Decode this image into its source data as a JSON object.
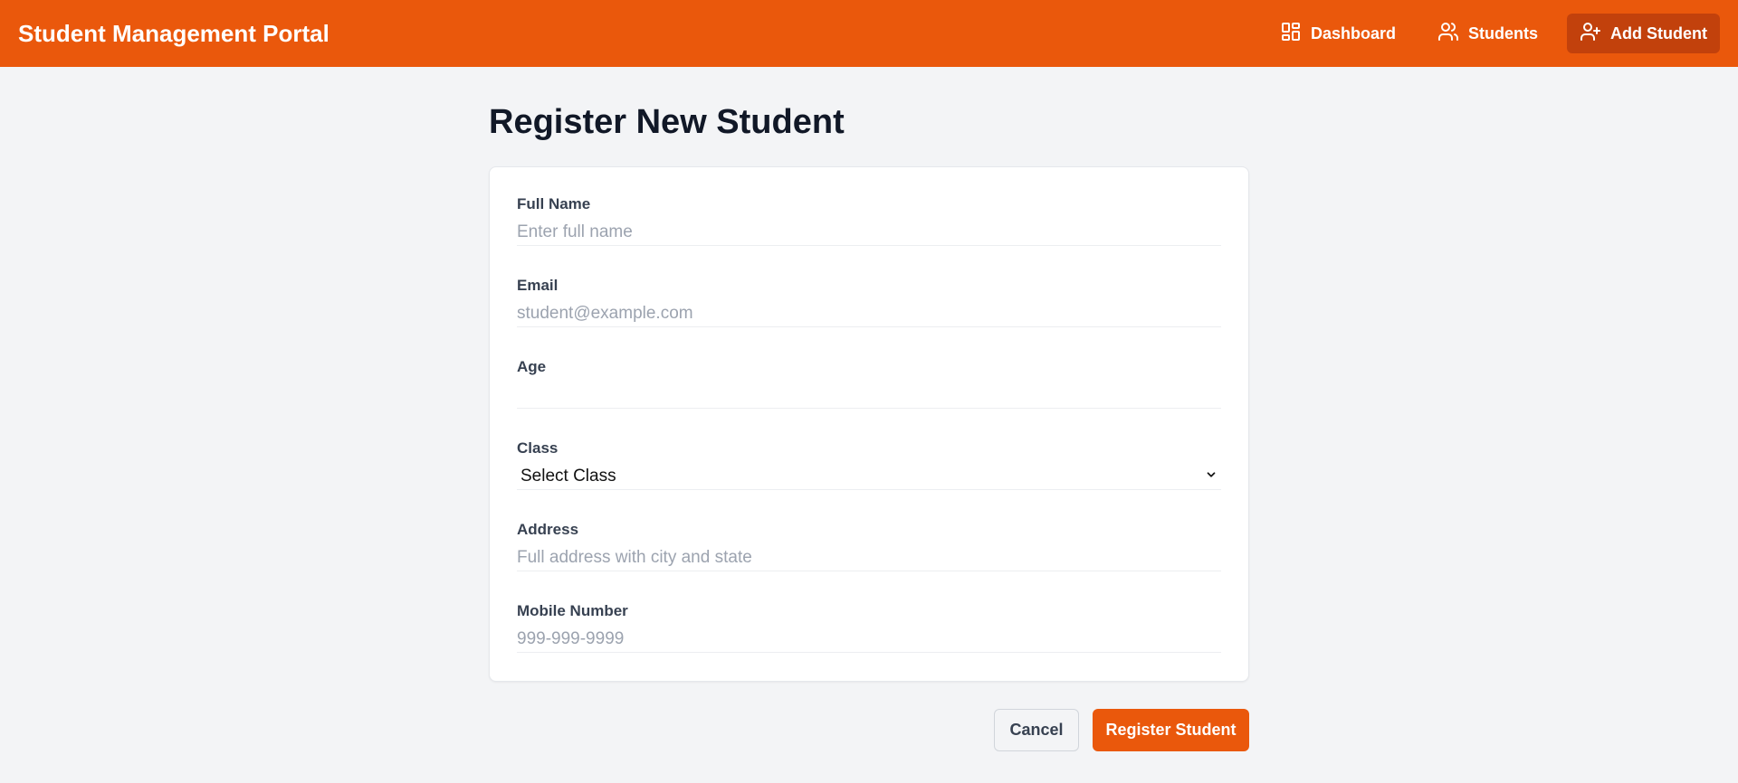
{
  "app": {
    "title": "Student Management Portal"
  },
  "nav": {
    "items": [
      {
        "label": "Dashboard",
        "icon": "dashboard-icon"
      },
      {
        "label": "Students",
        "icon": "users-icon"
      },
      {
        "label": "Add Student",
        "icon": "user-plus-icon",
        "active": true
      }
    ]
  },
  "page": {
    "title": "Register New Student"
  },
  "form": {
    "full_name": {
      "label": "Full Name",
      "placeholder": "Enter full name",
      "value": ""
    },
    "email": {
      "label": "Email",
      "placeholder": "student@example.com",
      "value": ""
    },
    "age": {
      "label": "Age",
      "placeholder": "",
      "value": ""
    },
    "class": {
      "label": "Class",
      "selected": "Select Class"
    },
    "address": {
      "label": "Address",
      "placeholder": "Full address with city and state",
      "value": ""
    },
    "mobile": {
      "label": "Mobile Number",
      "placeholder": "999-999-9999",
      "value": ""
    }
  },
  "actions": {
    "cancel_label": "Cancel",
    "submit_label": "Register Student"
  },
  "colors": {
    "accent": "#ea580c",
    "accent_dark": "#c2410c",
    "background": "#f3f4f6"
  }
}
